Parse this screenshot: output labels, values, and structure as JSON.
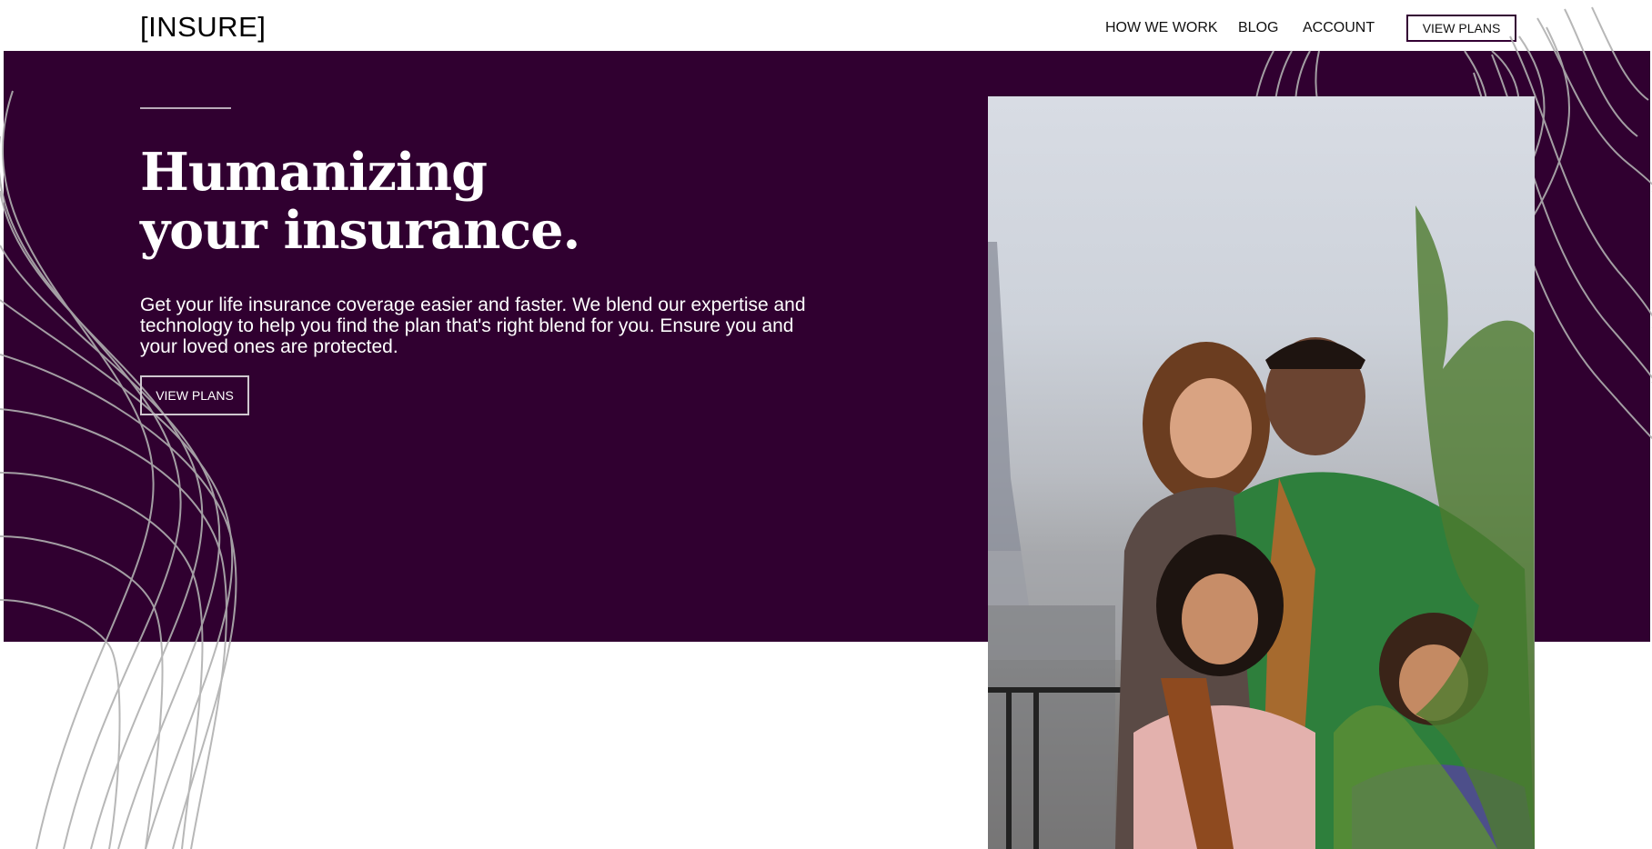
{
  "header": {
    "logo": "[INSURE]",
    "nav": [
      "HOW WE WORK",
      "BLOG",
      "ACCOUNT"
    ],
    "cta": "VIEW PLANS"
  },
  "hero": {
    "headline_line1": "Humanizing",
    "headline_line2": "your insurance.",
    "subtext": "Get your life insurance coverage easier and faster. We blend our expertise and technology to help you find the plan that's right blend for you. Ensure you and your loved ones are protected.",
    "cta": "VIEW PLANS"
  },
  "colors": {
    "hero_background": "#300030",
    "contour_lines": "#b0b0b0",
    "text_dark": "#111111",
    "text_light": "#ffffff"
  }
}
